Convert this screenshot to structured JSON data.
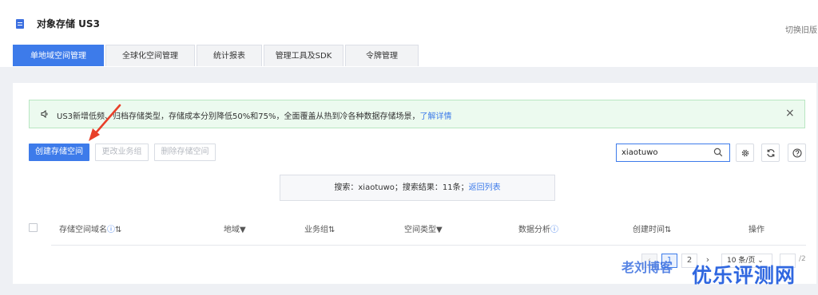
{
  "header": {
    "title": "对象存储 US3",
    "switch_old": "切换旧版"
  },
  "tabs": [
    {
      "label": "单地域空间管理",
      "active": true
    },
    {
      "label": "全球化空间管理",
      "active": false
    },
    {
      "label": "统计报表",
      "active": false
    },
    {
      "label": "管理工具及SDK",
      "active": false
    },
    {
      "label": "令牌管理",
      "active": false
    }
  ],
  "notice": {
    "text": "US3新增低频、归档存储类型，存储成本分别降低50%和75%，全面覆盖从热到冷各种数据存储场景，",
    "link": "了解详情",
    "close": "×"
  },
  "toolbar": {
    "create_label": "创建存储空间",
    "change_group_label": "更改业务组",
    "delete_label": "删除存储空间"
  },
  "search": {
    "value": "xiaotuwo"
  },
  "result": {
    "prefix": "搜索：xiaotuwo；搜索结果：11条；",
    "link": "返回列表"
  },
  "table": {
    "columns": [
      "存储空间域名",
      "地域",
      "业务组",
      "空间类型",
      "数据分析",
      "创建时间",
      "操作"
    ]
  },
  "pagination": {
    "prev": "‹",
    "pages": [
      "1",
      "2"
    ],
    "current": "1",
    "next": "›",
    "page_size": "10 条/页",
    "total": "/2"
  },
  "watermarks": {
    "left": "老刘博客",
    "right": "优乐评测网"
  },
  "colors": {
    "accent": "#3d7bea",
    "notice_bg": "#ecfaef",
    "arrow": "#e8402a"
  }
}
